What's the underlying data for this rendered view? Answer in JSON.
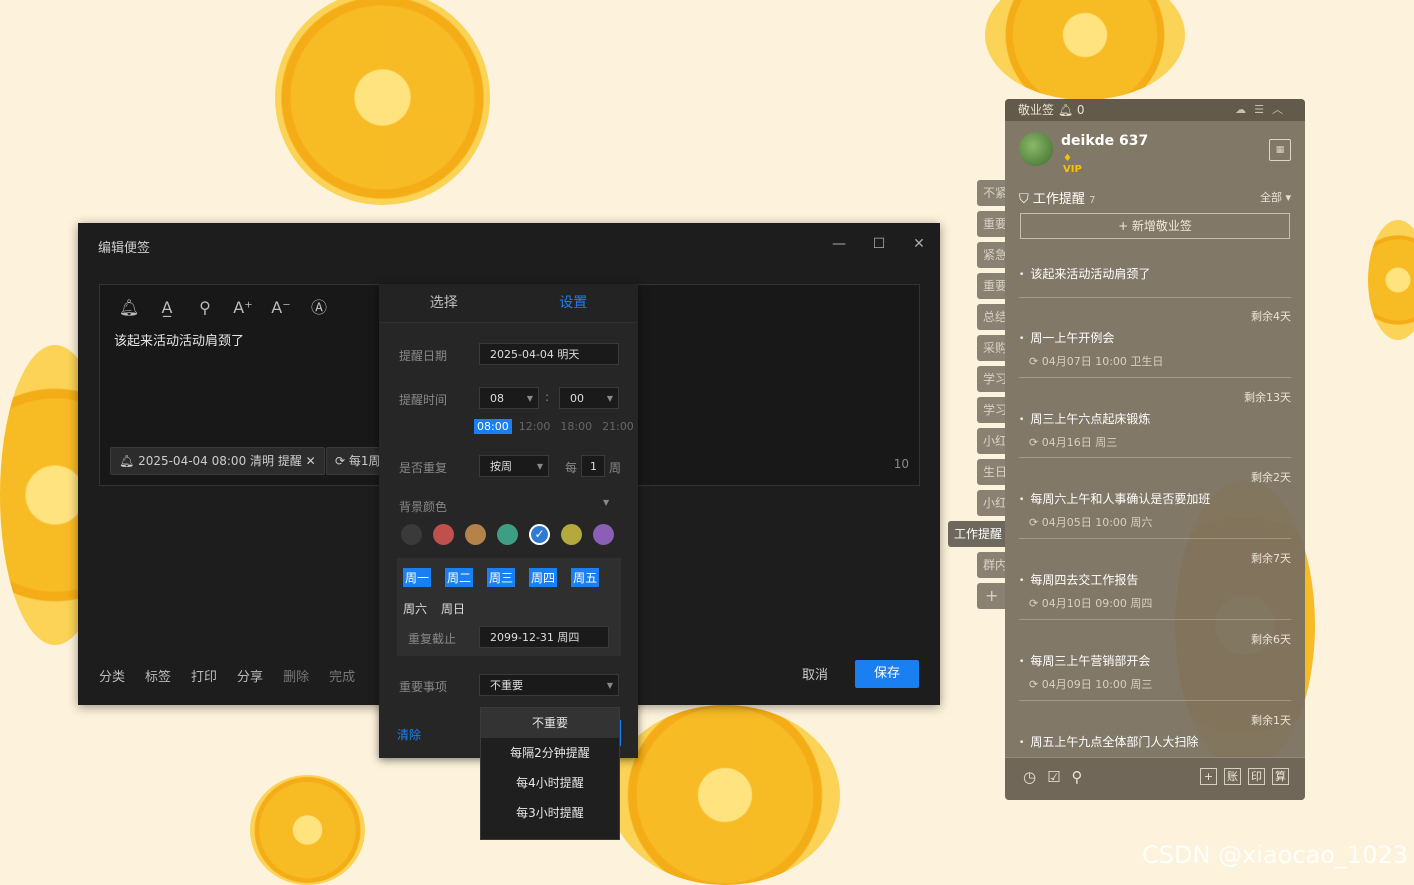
{
  "edit_window": {
    "title": "编辑便签",
    "note_text": "该起来活动活动肩颈了",
    "reminder_chip": "2025-04-04 08:00 清明 提醒",
    "repeat_chip": "每1周",
    "char_count": "10",
    "actions": [
      "分类",
      "标签",
      "打印",
      "分享",
      "删除",
      "完成"
    ],
    "cancel": "取消",
    "save": "保存"
  },
  "reminder_popup": {
    "tab_select": "选择",
    "tab_settings": "设置",
    "date_label": "提醒日期",
    "date_value": "2025-04-04 明天",
    "time_label": "提醒时间",
    "hour": "08",
    "minute": "00",
    "time_sep": ":",
    "quick_times": [
      "08:00",
      "12:00",
      "18:00",
      "21:00"
    ],
    "repeat_label": "是否重复",
    "repeat_mode": "按周",
    "every_label": "每",
    "every_value": "1",
    "unit_label": "周",
    "bg_color_label": "背景颜色",
    "colors": [
      "#3a3a3a",
      "#c0504d",
      "#b5824a",
      "#3d9e84",
      "#2f7bd1",
      "#b4a93c",
      "#8a5fb5"
    ],
    "weekdays": [
      {
        "label": "周一",
        "on": true
      },
      {
        "label": "周二",
        "on": true
      },
      {
        "label": "周三",
        "on": true
      },
      {
        "label": "周四",
        "on": true
      },
      {
        "label": "周五",
        "on": true
      },
      {
        "label": "周六",
        "on": false
      },
      {
        "label": "周日",
        "on": false
      }
    ],
    "repeat_end_label": "重复截止",
    "repeat_end_value": "2099-12-31 周四",
    "importance_label": "重要事项",
    "importance_value": "不重要",
    "clear": "清除",
    "importance_options": [
      "不重要",
      "每隔2分钟提醒",
      "每4小时提醒",
      "每3小时提醒"
    ]
  },
  "side_tabs": [
    "不紧",
    "重要",
    "紧急",
    "重要",
    "总结",
    "采购",
    "学习",
    "学习",
    "小红",
    "生日",
    "小红",
    "工作提醒",
    "群内",
    "+"
  ],
  "sticky_panel": {
    "app_name": "敬业签",
    "bell_count": "0",
    "username": "deikde 637",
    "vip": "VIP",
    "section_title": "工作提醒",
    "section_count": "7",
    "filter": "全部",
    "new_note": "+ 新增敬业签",
    "notes": [
      {
        "title": "该起来活动活动肩颈了",
        "remain": "",
        "sub": ""
      },
      {
        "title": "周一上午开例会",
        "remain": "剩余4天",
        "sub": "04月07日 10:00 卫生日"
      },
      {
        "title": "周三上午六点起床锻炼",
        "remain": "剩余13天",
        "sub": "04月16日 周三"
      },
      {
        "title": "每周六上午和人事确认是否要加班",
        "remain": "剩余2天",
        "sub": "04月05日 10:00 周六"
      },
      {
        "title": "每周四去交工作报告",
        "remain": "剩余7天",
        "sub": "04月10日 09:00 周四"
      },
      {
        "title": "每周三上午营销部开会",
        "remain": "剩余6天",
        "sub": "04月09日 10:00 周三"
      },
      {
        "title": "周五上午九点全体部门人大扫除",
        "remain": "剩余1天",
        "sub": ""
      }
    ],
    "foot_buttons": [
      "+",
      "账",
      "印",
      "算"
    ]
  },
  "watermark": "CSDN @xiaocao_1023"
}
